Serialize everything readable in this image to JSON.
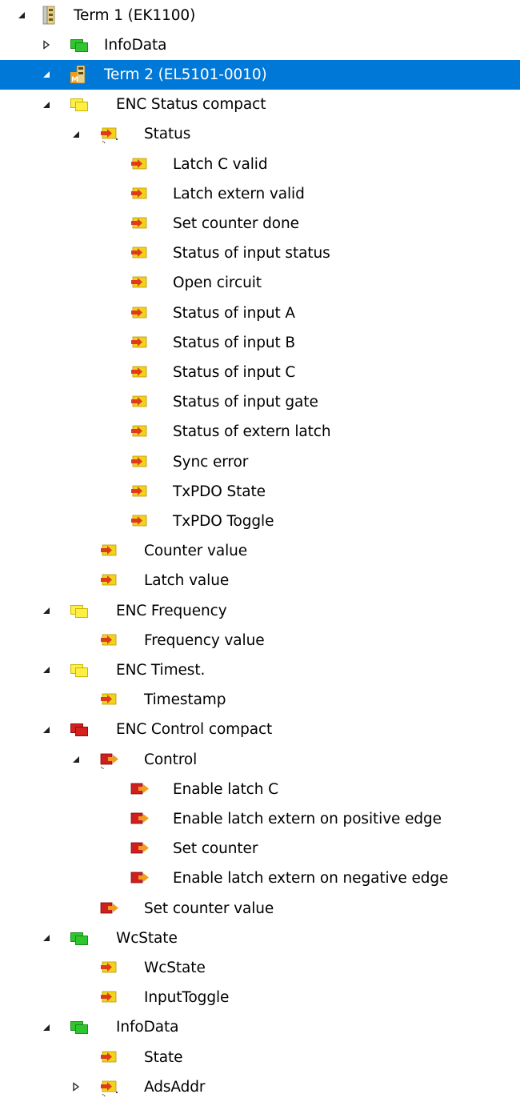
{
  "tree": {
    "rows": [
      {
        "label": "Term 1 (EK1100)",
        "icon": "coupler-terminal-icon",
        "expander": "expanded",
        "depth": 0,
        "selected": false
      },
      {
        "label": "InfoData",
        "icon": "green-folder-icon",
        "expander": "collapsed",
        "depth": 1,
        "selected": false
      },
      {
        "label": "Term 2 (EL5101-0010)",
        "icon": "io-terminal-icon",
        "expander": "expanded",
        "depth": 1,
        "selected": true
      },
      {
        "label": "ENC Status compact",
        "icon": "yellow-folder-icon",
        "expander": "expanded",
        "depth": 2,
        "selected": false
      },
      {
        "label": "Status",
        "icon": "input-struct-icon",
        "expander": "expanded",
        "depth": 3,
        "selected": false
      },
      {
        "label": "Latch C valid",
        "icon": "input-var-icon",
        "expander": "none",
        "depth": 4,
        "selected": false
      },
      {
        "label": "Latch extern valid",
        "icon": "input-var-icon",
        "expander": "none",
        "depth": 4,
        "selected": false
      },
      {
        "label": "Set counter done",
        "icon": "input-var-icon",
        "expander": "none",
        "depth": 4,
        "selected": false
      },
      {
        "label": "Status of input status",
        "icon": "input-var-icon",
        "expander": "none",
        "depth": 4,
        "selected": false
      },
      {
        "label": "Open circuit",
        "icon": "input-var-icon",
        "expander": "none",
        "depth": 4,
        "selected": false
      },
      {
        "label": "Status of input A",
        "icon": "input-var-icon",
        "expander": "none",
        "depth": 4,
        "selected": false
      },
      {
        "label": "Status of input B",
        "icon": "input-var-icon",
        "expander": "none",
        "depth": 4,
        "selected": false
      },
      {
        "label": "Status of input C",
        "icon": "input-var-icon",
        "expander": "none",
        "depth": 4,
        "selected": false
      },
      {
        "label": "Status of input gate",
        "icon": "input-var-icon",
        "expander": "none",
        "depth": 4,
        "selected": false
      },
      {
        "label": "Status of extern latch",
        "icon": "input-var-icon",
        "expander": "none",
        "depth": 4,
        "selected": false
      },
      {
        "label": "Sync error",
        "icon": "input-var-icon",
        "expander": "none",
        "depth": 4,
        "selected": false
      },
      {
        "label": "TxPDO State",
        "icon": "input-var-icon",
        "expander": "none",
        "depth": 4,
        "selected": false
      },
      {
        "label": "TxPDO Toggle",
        "icon": "input-var-icon",
        "expander": "none",
        "depth": 4,
        "selected": false
      },
      {
        "label": "Counter value",
        "icon": "input-var-icon",
        "expander": "none",
        "depth": 3,
        "selected": false
      },
      {
        "label": "Latch value",
        "icon": "input-var-icon",
        "expander": "none",
        "depth": 3,
        "selected": false
      },
      {
        "label": "ENC Frequency",
        "icon": "yellow-folder-icon",
        "expander": "expanded",
        "depth": 2,
        "selected": false
      },
      {
        "label": "Frequency value",
        "icon": "input-var-icon",
        "expander": "none",
        "depth": 3,
        "selected": false
      },
      {
        "label": "ENC Timest.",
        "icon": "yellow-folder-icon",
        "expander": "expanded",
        "depth": 2,
        "selected": false
      },
      {
        "label": "Timestamp",
        "icon": "input-var-icon",
        "expander": "none",
        "depth": 3,
        "selected": false
      },
      {
        "label": "ENC Control compact",
        "icon": "red-folder-icon",
        "expander": "expanded",
        "depth": 2,
        "selected": false
      },
      {
        "label": "Control",
        "icon": "output-struct-icon",
        "expander": "expanded",
        "depth": 3,
        "selected": false
      },
      {
        "label": "Enable latch C",
        "icon": "output-var-icon",
        "expander": "none",
        "depth": 4,
        "selected": false
      },
      {
        "label": "Enable latch extern on positive edge",
        "icon": "output-var-icon",
        "expander": "none",
        "depth": 4,
        "selected": false
      },
      {
        "label": "Set counter",
        "icon": "output-var-icon",
        "expander": "none",
        "depth": 4,
        "selected": false
      },
      {
        "label": "Enable latch extern on negative edge",
        "icon": "output-var-icon",
        "expander": "none",
        "depth": 4,
        "selected": false
      },
      {
        "label": "Set counter value",
        "icon": "output-var-icon",
        "expander": "none",
        "depth": 3,
        "selected": false
      },
      {
        "label": "WcState",
        "icon": "green-folder-icon",
        "expander": "expanded",
        "depth": 2,
        "selected": false
      },
      {
        "label": "WcState",
        "icon": "input-var-icon",
        "expander": "none",
        "depth": 3,
        "selected": false
      },
      {
        "label": "InputToggle",
        "icon": "input-var-icon",
        "expander": "none",
        "depth": 3,
        "selected": false
      },
      {
        "label": "InfoData",
        "icon": "green-folder-icon",
        "expander": "expanded",
        "depth": 2,
        "selected": false
      },
      {
        "label": "State",
        "icon": "input-var-icon",
        "expander": "none",
        "depth": 3,
        "selected": false
      },
      {
        "label": "AdsAddr",
        "icon": "input-struct-icon",
        "expander": "collapsed",
        "depth": 3,
        "selected": false
      }
    ]
  },
  "colors": {
    "selection": "#0078d7",
    "selection_text": "#ffffff",
    "folder_yellow": "#ffee44",
    "folder_green": "#2ec52e",
    "folder_red": "#d61f1f",
    "input_var": "#f2d21a",
    "input_arrow": "#e03a1e",
    "output_var": "#cf1f1f",
    "output_arrow": "#f39c1a"
  }
}
